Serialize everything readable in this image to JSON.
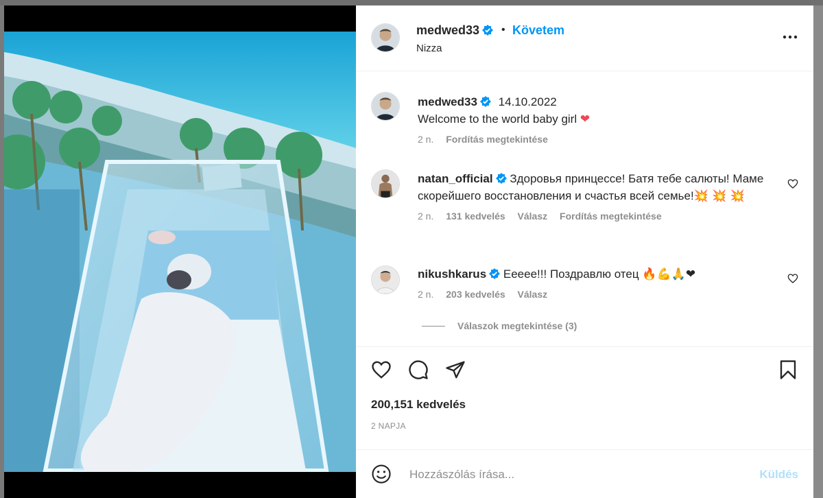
{
  "colors": {
    "accent": "#0095f6",
    "verified": "#0095f6",
    "muted": "#8e8e8e",
    "text": "#262626"
  },
  "header": {
    "username": "medwed33",
    "separator": "•",
    "follow_label": "Követem",
    "location": "Nizza"
  },
  "caption": {
    "username": "medwed33",
    "date": "14.10.2022",
    "text": "Welcome to the world baby girl",
    "emoji": "❤",
    "age": "2 n.",
    "translate": "Fordítás megtekintése"
  },
  "comments": [
    {
      "username": "natan_official",
      "text": "Здоровья принцессе! Батя тебе салюты! Маме скорейшего восстановления и счастья всей семье!",
      "emoji": "💥 💥 💥",
      "age": "2 n.",
      "likes": "131 kedvelés",
      "reply": "Válasz",
      "translate": "Fordítás megtekintése"
    },
    {
      "username": "nikushkarus",
      "text": "Eeeee!!! Поздравлю отец",
      "emoji": "🔥💪🙏❤",
      "age": "2 n.",
      "likes": "203 kedvelés",
      "reply": "Válasz"
    }
  ],
  "view_replies": "Válaszok megtekintése (3)",
  "likes": "200,151 kedvelés",
  "date": "2 NAPJA",
  "comment_box": {
    "placeholder": "Hozzászólás írása...",
    "send_label": "Küldés"
  },
  "icons": [
    "more-icon",
    "like-icon",
    "comment-icon",
    "share-icon",
    "save-icon",
    "emoji-icon",
    "verified-icon",
    "heart-icon"
  ]
}
